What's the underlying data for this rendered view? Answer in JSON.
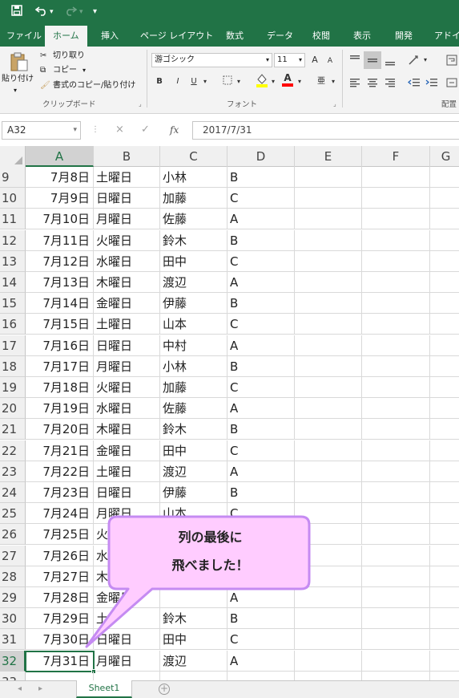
{
  "qat": {
    "save_icon": "save-icon",
    "undo_icon": "undo-icon",
    "redo_icon": "redo-icon",
    "customize_icon": "customize-qat-icon"
  },
  "tabs": [
    "ファイル",
    "ホーム",
    "挿入",
    "ページ レイアウト",
    "数式",
    "データ",
    "校閲",
    "表示",
    "開発",
    "アドイ"
  ],
  "active_tab": "ホーム",
  "ribbon": {
    "clipboard": {
      "paste": "貼り付け",
      "cut": "切り取り",
      "copy": "コピー",
      "format_painter": "書式のコピー/貼り付け",
      "label": "クリップボード"
    },
    "font": {
      "font_name": "游ゴシック",
      "font_size": "11",
      "grow": "A",
      "shrink": "A",
      "bold": "B",
      "italic": "I",
      "underline": "U",
      "font_color_letter": "A",
      "phonetic": "亜",
      "label": "フォント"
    },
    "alignment_label": "配置",
    "colors": {
      "accent": "#217346",
      "fill_yellow": "#ffff00",
      "font_red": "#ff0000"
    }
  },
  "formula_bar": {
    "name_box": "A32",
    "cancel": "×",
    "enter": "✓",
    "fx": "fx",
    "value": "2017/7/31"
  },
  "columns": [
    "A",
    "B",
    "C",
    "D",
    "E",
    "F",
    "G"
  ],
  "selected_column": "A",
  "rows": [
    {
      "num": "9",
      "a": "7月8日",
      "b": "土曜日",
      "c": "小林",
      "d": "B"
    },
    {
      "num": "10",
      "a": "7月9日",
      "b": "日曜日",
      "c": "加藤",
      "d": "C"
    },
    {
      "num": "11",
      "a": "7月10日",
      "b": "月曜日",
      "c": "佐藤",
      "d": "A"
    },
    {
      "num": "12",
      "a": "7月11日",
      "b": "火曜日",
      "c": "鈴木",
      "d": "B"
    },
    {
      "num": "13",
      "a": "7月12日",
      "b": "水曜日",
      "c": "田中",
      "d": "C"
    },
    {
      "num": "14",
      "a": "7月13日",
      "b": "木曜日",
      "c": "渡辺",
      "d": "A"
    },
    {
      "num": "15",
      "a": "7月14日",
      "b": "金曜日",
      "c": "伊藤",
      "d": "B"
    },
    {
      "num": "16",
      "a": "7月15日",
      "b": "土曜日",
      "c": "山本",
      "d": "C"
    },
    {
      "num": "17",
      "a": "7月16日",
      "b": "日曜日",
      "c": "中村",
      "d": "A"
    },
    {
      "num": "18",
      "a": "7月17日",
      "b": "月曜日",
      "c": "小林",
      "d": "B"
    },
    {
      "num": "19",
      "a": "7月18日",
      "b": "火曜日",
      "c": "加藤",
      "d": "C"
    },
    {
      "num": "20",
      "a": "7月19日",
      "b": "水曜日",
      "c": "佐藤",
      "d": "A"
    },
    {
      "num": "21",
      "a": "7月20日",
      "b": "木曜日",
      "c": "鈴木",
      "d": "B"
    },
    {
      "num": "22",
      "a": "7月21日",
      "b": "金曜日",
      "c": "田中",
      "d": "C"
    },
    {
      "num": "23",
      "a": "7月22日",
      "b": "土曜日",
      "c": "渡辺",
      "d": "A"
    },
    {
      "num": "24",
      "a": "7月23日",
      "b": "日曜日",
      "c": "伊藤",
      "d": "B"
    },
    {
      "num": "25",
      "a": "7月24日",
      "b": "月曜日",
      "c": "山本",
      "d": "C"
    },
    {
      "num": "26",
      "a": "7月25日",
      "b": "火",
      "c": "",
      "d": ""
    },
    {
      "num": "27",
      "a": "7月26日",
      "b": "水",
      "c": "",
      "d": ""
    },
    {
      "num": "28",
      "a": "7月27日",
      "b": "木",
      "c": "",
      "d": ""
    },
    {
      "num": "29",
      "a": "7月28日",
      "b": "金曜日",
      "c": "",
      "d": "A"
    },
    {
      "num": "30",
      "a": "7月29日",
      "b": "土",
      "c": "鈴木",
      "d": "B"
    },
    {
      "num": "31",
      "a": "7月30日",
      "b": "日曜日",
      "c": "田中",
      "d": "C"
    },
    {
      "num": "32",
      "a": "7月31日",
      "b": "月曜日",
      "c": "渡辺",
      "d": "A"
    },
    {
      "num": "33",
      "a": "",
      "b": "",
      "c": "",
      "d": ""
    }
  ],
  "selected_row": "32",
  "callout": {
    "line1": "列の最後に",
    "line2": "飛べました！",
    "fill": "#ffccff",
    "border": "#c58bf2"
  },
  "sheet_tab": "Sheet1"
}
